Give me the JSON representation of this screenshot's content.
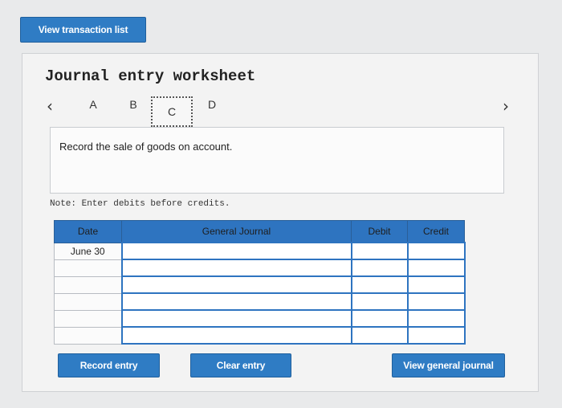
{
  "top_button_label": "View transaction list",
  "worksheet": {
    "title": "Journal entry worksheet",
    "tabs": [
      "A",
      "B",
      "C",
      "D"
    ],
    "active_tab": "C",
    "description": "Record the sale of goods on account.",
    "note": "Note: Enter debits before credits."
  },
  "table": {
    "headers": [
      "Date",
      "General Journal",
      "Debit",
      "Credit"
    ],
    "rows": [
      {
        "date": "June 30",
        "account": "",
        "debit": "",
        "credit": ""
      },
      {
        "date": "",
        "account": "",
        "debit": "",
        "credit": ""
      },
      {
        "date": "",
        "account": "",
        "debit": "",
        "credit": ""
      },
      {
        "date": "",
        "account": "",
        "debit": "",
        "credit": ""
      },
      {
        "date": "",
        "account": "",
        "debit": "",
        "credit": ""
      },
      {
        "date": "",
        "account": "",
        "debit": "",
        "credit": ""
      }
    ]
  },
  "footer_buttons": {
    "record": "Record entry",
    "clear": "Clear entry",
    "view_general": "View general journal"
  },
  "colors": {
    "accent": "#2f7cc4",
    "background": "#e9eaeb"
  }
}
